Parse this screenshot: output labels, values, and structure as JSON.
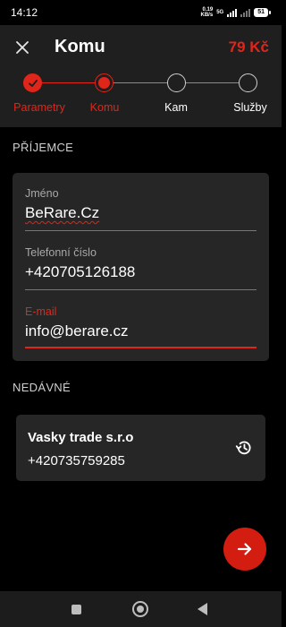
{
  "status_bar": {
    "time": "14:12",
    "net_speed_value": "0.19",
    "net_speed_unit": "KB/s",
    "network_type": "5G",
    "battery": "51"
  },
  "header": {
    "title": "Komu",
    "price": "79 Kč"
  },
  "stepper": {
    "steps": [
      {
        "label": "Parametry",
        "state": "done"
      },
      {
        "label": "Komu",
        "state": "active"
      },
      {
        "label": "Kam",
        "state": "pending"
      },
      {
        "label": "Služby",
        "state": "pending"
      }
    ]
  },
  "recipient": {
    "section_title": "PŘÍJEMCE",
    "name_label": "Jméno",
    "name_value": "BeRare.Cz",
    "phone_label": "Telefonní číslo",
    "phone_value": "+420705126188",
    "email_label": "E-mail",
    "email_value": "info@berare.cz"
  },
  "recent": {
    "section_title": "NEDÁVNÉ",
    "items": [
      {
        "name": "Vasky trade s.r.o",
        "phone": "+420735759285"
      }
    ]
  },
  "icons": {
    "close": "close-icon",
    "history": "history-icon",
    "next": "arrow-right-icon",
    "check": "check-icon"
  },
  "colors": {
    "accent": "#e0261a",
    "background": "#000000",
    "header_bg": "#1f1f1f",
    "card_bg": "#262626"
  }
}
